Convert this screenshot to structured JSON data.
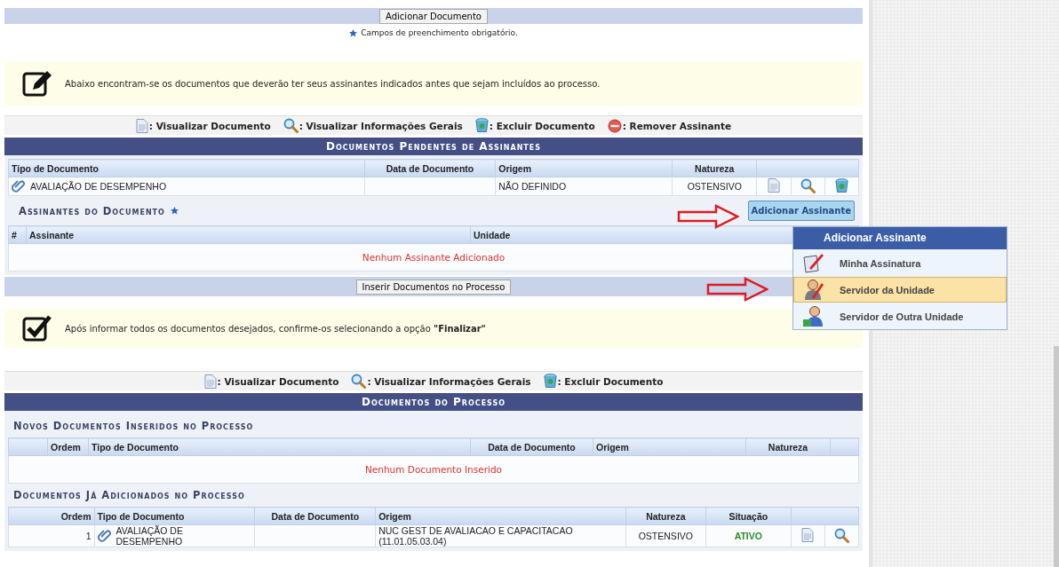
{
  "top_bar": {
    "button": "Adicionar Documento"
  },
  "required_note": "Campos de preenchimento obrigatório.",
  "info_notice": {
    "kind": "edit",
    "text": "Abaixo encontram-se os documentos que deverão ter seus assinantes indicados antes que sejam incluídos ao processo."
  },
  "pending": {
    "legend": [
      {
        "kind": "view",
        "label": ": Visualizar Documento"
      },
      {
        "kind": "info",
        "label": ": Visualizar Informações Gerais"
      },
      {
        "kind": "delete",
        "label": ": Excluir Documento"
      },
      {
        "kind": "remove",
        "label": ": Remover Assinante"
      }
    ],
    "title": "Documentos Pendentes de Assinantes",
    "columns": [
      "Tipo de Documento",
      "Data de Documento",
      "Origem",
      "Natureza"
    ],
    "rows": [
      {
        "tipo": "AVALIAÇÃO DE DESEMPENHO",
        "origem": "NÃO DEFINIDO",
        "natureza": "OSTENSIVO",
        "actions": [
          {
            "kind": "view"
          },
          {
            "kind": "info"
          },
          {
            "kind": "delete"
          }
        ]
      }
    ],
    "signers": {
      "title": "Assinantes do Documento",
      "button": "Adicionar Assinante",
      "columns": [
        "#",
        "Assinante",
        "Unidade"
      ],
      "empty": "Nenhum Assinante Adicionado"
    },
    "insert_button": "Inserir Documentos no Processo"
  },
  "menu": {
    "title": "Adicionar Assinante",
    "items": [
      {
        "kind": "own-signature",
        "label": "Minha Assinatura",
        "selected": false
      },
      {
        "kind": "unit-server",
        "label": "Servidor da Unidade",
        "selected": true
      },
      {
        "kind": "other-unit-server",
        "label": "Servidor de Outra Unidade",
        "selected": false
      }
    ]
  },
  "finish_notice": {
    "kind": "check",
    "text": "Após informar todos os documentos desejados, confirme-os selecionando a opção **\"Finalizar\"**"
  },
  "process": {
    "legend": [
      {
        "kind": "view",
        "label": ": Visualizar Documento"
      },
      {
        "kind": "info",
        "label": ": Visualizar Informações Gerais"
      },
      {
        "kind": "delete",
        "label": ": Excluir Documento"
      }
    ],
    "title": "Documentos do Processo",
    "new_docs": {
      "title": "Novos Documentos Inseridos no Processo",
      "columns": [
        "Ordem",
        "Tipo de Documento",
        "Data de Documento",
        "Origem",
        "Natureza"
      ],
      "empty": "Nenhum Documento Inserido"
    },
    "added_docs": {
      "title": "Documentos Já Adicionados no Processo",
      "columns": [
        "Ordem",
        "Tipo de Documento",
        "Data de Documento",
        "Origem",
        "Natureza",
        "Situação"
      ],
      "rows": [
        {
          "ordem": "1",
          "tipo": "AVALIAÇÃO DE DESEMPENHO",
          "origem": "NUC GEST DE AVALIACAO E CAPACITACAO (11.01.05.03.04)",
          "natureza": "OSTENSIVO",
          "situacao": "ATIVO",
          "actions": [
            {
              "kind": "view"
            },
            {
              "kind": "info"
            }
          ]
        }
      ]
    }
  }
}
